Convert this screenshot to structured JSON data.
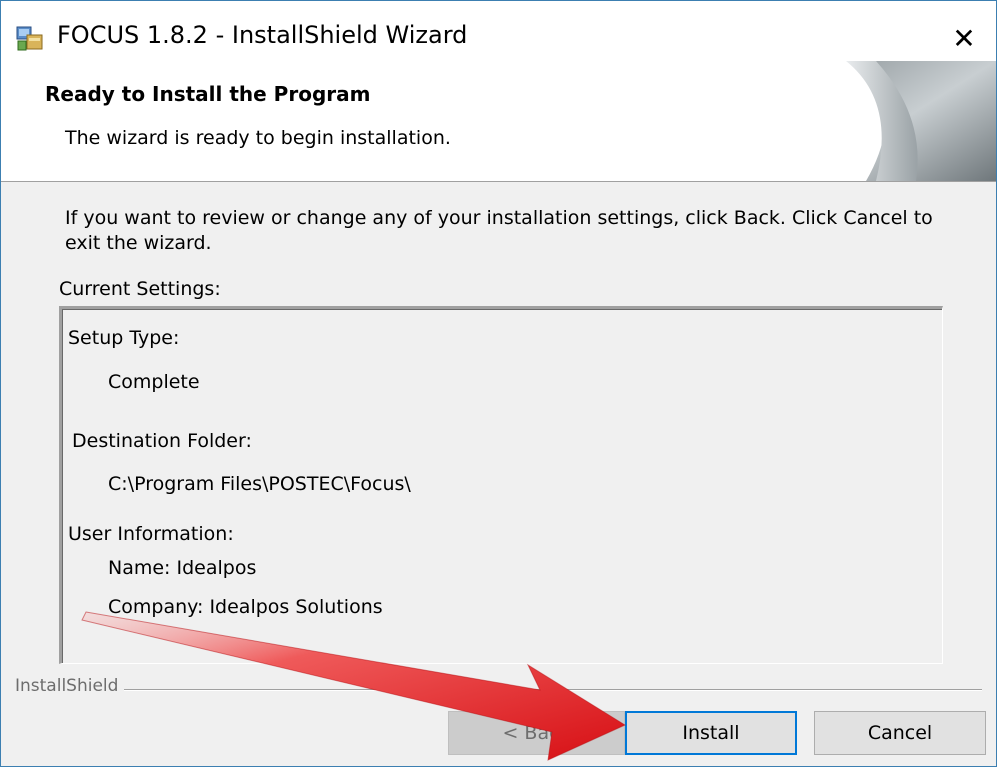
{
  "window": {
    "title": "FOCUS 1.8.2 - InstallShield Wizard",
    "close_glyph": "✕"
  },
  "header": {
    "title": "Ready to Install the Program",
    "subtitle": "The wizard is ready to begin installation."
  },
  "body": {
    "intro": "If you want to review or change any of your installation settings, click Back. Click Cancel to exit the wizard.",
    "settings_label": "Current Settings:"
  },
  "settings": {
    "setup_type_label": "Setup Type:",
    "setup_type_value": "Complete",
    "destination_label": "Destination Folder:",
    "destination_value": "C:\\Program Files\\POSTEC\\Focus\\",
    "user_info_label": "User Information:",
    "user_name": "Name: Idealpos",
    "user_company": "Company: Idealpos Solutions"
  },
  "footer": {
    "brand": "InstallShield",
    "back_label": "< Back",
    "install_label": "Install",
    "cancel_label": "Cancel"
  },
  "colors": {
    "accent": "#0078d7",
    "arrow": "#e0161b"
  }
}
